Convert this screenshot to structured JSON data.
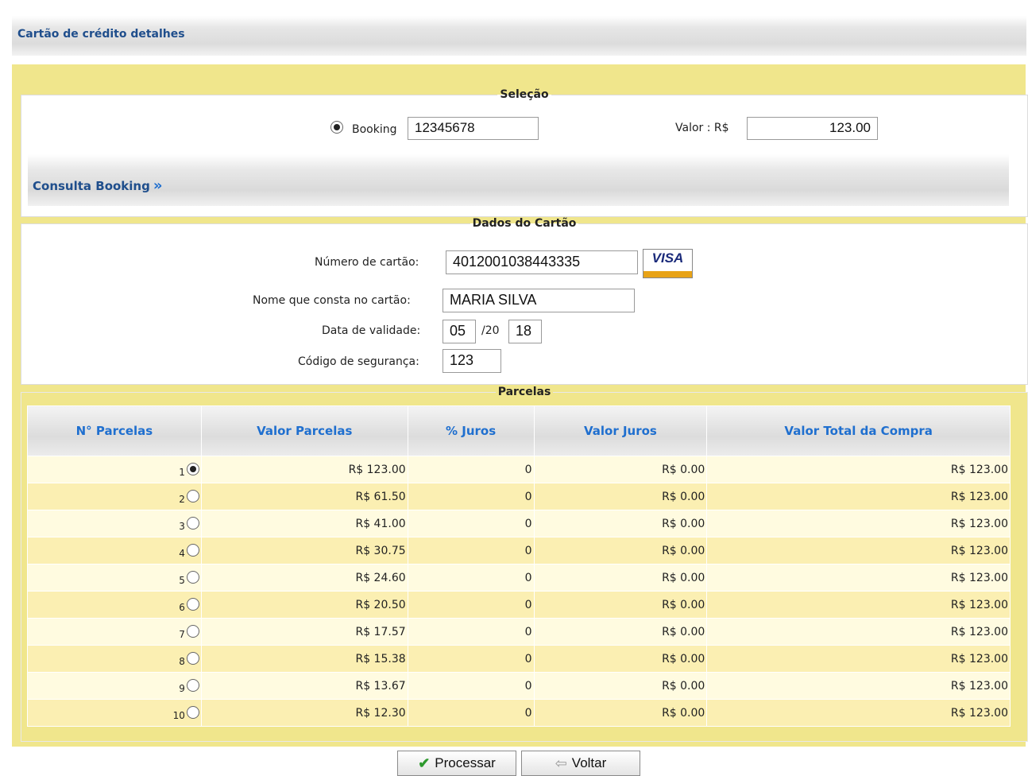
{
  "header": {
    "title": "Cartão de crédito detalhes"
  },
  "selecao": {
    "legend": "Seleção",
    "booking_label": "Booking",
    "booking_value": "12345678",
    "valor_label": "Valor : R$",
    "valor_value": "123.00",
    "consulta_label": "Consulta Booking"
  },
  "dados": {
    "legend": "Dados do Cartão",
    "numero_label": "Número de cartão:",
    "numero_value": "4012001038443335",
    "card_brand": "VISA",
    "nome_label": "Nome que consta no cartão:",
    "nome_value": "MARIA SILVA",
    "validade_label": "Data de validade:",
    "validade_mes": "05",
    "validade_sep": "/20",
    "validade_ano": "18",
    "codigo_label": "Código de segurança:",
    "codigo_value": "123"
  },
  "parcelas": {
    "legend": "Parcelas",
    "headers": [
      "N° Parcelas",
      "Valor Parcelas",
      "% Juros",
      "Valor Juros",
      "Valor Total da Compra"
    ],
    "rows": [
      {
        "n": "1",
        "valor": "R$ 123.00",
        "juros": "0",
        "valor_juros": "R$ 0.00",
        "total": "R$ 123.00",
        "selected": true
      },
      {
        "n": "2",
        "valor": "R$ 61.50",
        "juros": "0",
        "valor_juros": "R$ 0.00",
        "total": "R$ 123.00",
        "selected": false
      },
      {
        "n": "3",
        "valor": "R$ 41.00",
        "juros": "0",
        "valor_juros": "R$ 0.00",
        "total": "R$ 123.00",
        "selected": false
      },
      {
        "n": "4",
        "valor": "R$ 30.75",
        "juros": "0",
        "valor_juros": "R$ 0.00",
        "total": "R$ 123.00",
        "selected": false
      },
      {
        "n": "5",
        "valor": "R$ 24.60",
        "juros": "0",
        "valor_juros": "R$ 0.00",
        "total": "R$ 123.00",
        "selected": false
      },
      {
        "n": "6",
        "valor": "R$ 20.50",
        "juros": "0",
        "valor_juros": "R$ 0.00",
        "total": "R$ 123.00",
        "selected": false
      },
      {
        "n": "7",
        "valor": "R$ 17.57",
        "juros": "0",
        "valor_juros": "R$ 0.00",
        "total": "R$ 123.00",
        "selected": false
      },
      {
        "n": "8",
        "valor": "R$ 15.38",
        "juros": "0",
        "valor_juros": "R$ 0.00",
        "total": "R$ 123.00",
        "selected": false
      },
      {
        "n": "9",
        "valor": "R$ 13.67",
        "juros": "0",
        "valor_juros": "R$ 0.00",
        "total": "R$ 123.00",
        "selected": false
      },
      {
        "n": "10",
        "valor": "R$ 12.30",
        "juros": "0",
        "valor_juros": "R$ 0.00",
        "total": "R$ 123.00",
        "selected": false
      }
    ]
  },
  "buttons": {
    "processar": "Processar",
    "voltar": "Voltar"
  },
  "icons": {
    "processar": "check-icon",
    "voltar": "arrow-left-icon",
    "consulta": "double-chevron-right-icon"
  },
  "colors": {
    "frame": "#f0e68c",
    "link": "#1f4e8c",
    "header_text": "#1f6fcf",
    "row_odd": "#fffbe0",
    "row_even": "#fbefb2"
  }
}
